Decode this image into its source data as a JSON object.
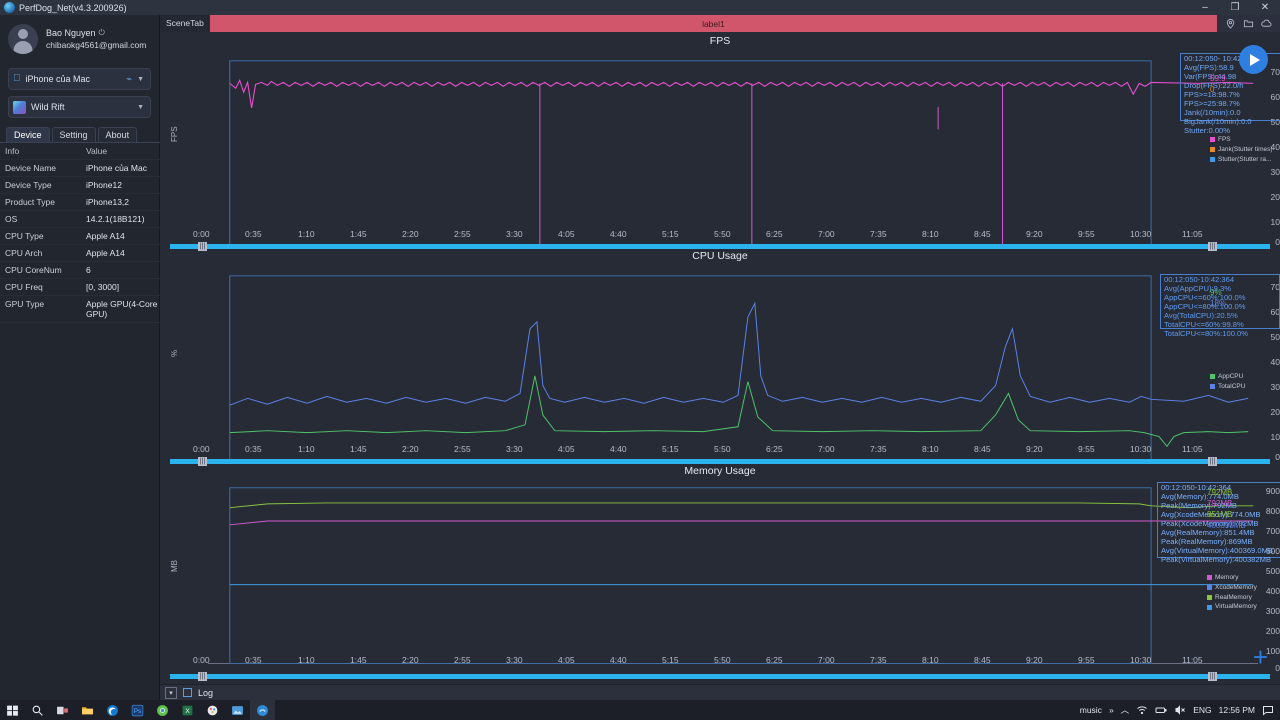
{
  "window": {
    "title": "PerfDog_Net(v4.3.200926)",
    "minimize": "–",
    "maximize": "❐",
    "close": "✕"
  },
  "sidebar": {
    "account": {
      "name": "Bao Nguyen",
      "power_icon": "⏻",
      "email": "chibaokg4561@gmail.com"
    },
    "device_combo": {
      "label": "iPhone của Mac",
      "apple_icon": "",
      "link_icon": "⌁",
      "caret": "▼"
    },
    "app_combo": {
      "label": "Wild Rift",
      "caret": "▼"
    },
    "tabs": [
      {
        "label": "Device",
        "active": true
      },
      {
        "label": "Setting",
        "active": false
      },
      {
        "label": "About",
        "active": false
      }
    ],
    "table": {
      "headers": [
        "Info",
        "Value"
      ],
      "rows": [
        [
          "Device Name",
          "iPhone của Mac"
        ],
        [
          "Device Type",
          "iPhone12"
        ],
        [
          "Product Type",
          "iPhone13,2"
        ],
        [
          "OS",
          "14.2.1(18B121)"
        ],
        [
          "CPU Type",
          "Apple A14"
        ],
        [
          "CPU Arch",
          "Apple A14"
        ],
        [
          "CPU CoreNum",
          "6"
        ],
        [
          "CPU Freq",
          "[0, 3000]"
        ],
        [
          "GPU Type",
          "Apple GPU(4-Core GPU)"
        ]
      ]
    }
  },
  "scenebar": {
    "label": "SceneTab",
    "tag": "label1",
    "tag_color": "#d1566b",
    "icons": [
      "location-pin-icon",
      "folder-icon",
      "cloud-icon"
    ]
  },
  "controls": {
    "play_label": "play-button",
    "add_label": "+",
    "log_checkbox_label": "Log",
    "expand_label": "▾"
  },
  "chart_data": [
    {
      "type": "line",
      "title": "FPS",
      "xlabel": "",
      "ylabel": "FPS",
      "ylim": [
        0,
        70
      ],
      "yticks": [
        0,
        10,
        20,
        30,
        40,
        50,
        60,
        70
      ],
      "xticks": [
        "0:00",
        "0:35",
        "1:10",
        "1:45",
        "2:20",
        "2:55",
        "3:30",
        "4:05",
        "4:40",
        "5:15",
        "5:50",
        "6:25",
        "7:00",
        "7:35",
        "8:10",
        "8:45",
        "9:20",
        "9:55",
        "10:30",
        "11:05"
      ],
      "grid": false,
      "legend_position": "right",
      "legend": [
        {
          "name": "FPS",
          "color": "#e84fd0"
        },
        {
          "name": "Jank(Stutter times)",
          "color": "#e8892a"
        },
        {
          "name": "Stutter(Stutter ra...",
          "color": "#3f9ae8"
        }
      ],
      "annotation": {
        "range": "00:12:050- 10:42:364",
        "lines": [
          "Avg(FPS):58.9",
          "Var(FPS):44.98",
          "Drop(FPS):22.0/h",
          "FPS>=18:98.7%",
          "FPS>=25:98.7%",
          "Jank(/10min):0.0",
          "BigJank(/10min):0.0",
          "Stutter:0.00%"
        ]
      },
      "current_values": [
        {
          "value": "59.9",
          "color": "#e84fd0"
        },
        {
          "value": "0",
          "color": "#e8892a"
        }
      ],
      "series": [
        {
          "name": "FPS",
          "color": "#e84fd0",
          "avg": 58.9,
          "baseline": 59.5
        }
      ]
    },
    {
      "type": "line",
      "title": "CPU Usage",
      "xlabel": "",
      "ylabel": "%",
      "ylim": [
        0,
        70
      ],
      "yticks": [
        0,
        10,
        20,
        30,
        40,
        50,
        60,
        70
      ],
      "xticks": [
        "0:00",
        "0:35",
        "1:10",
        "1:45",
        "2:20",
        "2:55",
        "3:30",
        "4:05",
        "4:40",
        "5:15",
        "5:50",
        "6:25",
        "7:00",
        "7:35",
        "8:10",
        "8:45",
        "9:20",
        "9:55",
        "10:30",
        "11:05"
      ],
      "grid": false,
      "legend_position": "right",
      "legend": [
        {
          "name": "AppCPU",
          "color": "#4fc46a"
        },
        {
          "name": "TotalCPU",
          "color": "#5c82e8"
        }
      ],
      "annotation": {
        "range": "00:12:050-10:42:364",
        "lines": [
          "Avg(AppCPU):9.3%",
          "AppCPU<=60%:100.0%",
          "AppCPU<=80%:100.0%",
          "Avg(TotalCPU):20.5%",
          "TotalCPU<=60%:99.8%",
          "TotalCPU<=80%:100.0%"
        ]
      },
      "current_values": [
        {
          "value": "9%",
          "color": "#4fc46a"
        },
        {
          "value": "18%",
          "color": "#5c82e8"
        }
      ],
      "series": [
        {
          "name": "AppCPU",
          "color": "#4fc46a",
          "avg": 9.3,
          "baseline": 9
        },
        {
          "name": "TotalCPU",
          "color": "#5c82e8",
          "avg": 20.5,
          "baseline": 20
        }
      ]
    },
    {
      "type": "line",
      "title": "Memory Usage",
      "xlabel": "",
      "ylabel": "MB",
      "ylim": [
        0,
        900
      ],
      "yticks": [
        0,
        100,
        200,
        300,
        400,
        500,
        600,
        700,
        800,
        900
      ],
      "xticks": [
        "0:00",
        "0:35",
        "1:10",
        "1:45",
        "2:20",
        "2:55",
        "3:30",
        "4:05",
        "4:40",
        "5:15",
        "5:50",
        "6:25",
        "7:00",
        "7:35",
        "8:10",
        "8:45",
        "9:20",
        "9:55",
        "10:30",
        "11:05"
      ],
      "grid": false,
      "legend_position": "right",
      "legend": [
        {
          "name": "Memory",
          "color": "#d05ad0"
        },
        {
          "name": "XcodeMemory",
          "color": "#5c82e8"
        },
        {
          "name": "RealMemory",
          "color": "#8cc63f"
        },
        {
          "name": "VirtualMemory",
          "color": "#3f9ae8"
        }
      ],
      "annotation": {
        "range": "00:12:050-10:42:364",
        "lines": [
          "Avg(Memory):774.0MB",
          "Peak(Memory):792MB",
          "Avg(XcodeMemory):774.0MB",
          "Peak(XcodeMemory):792MB",
          "Avg(RealMemory):851.4MB",
          "Peak(RealMemory):869MB",
          "Avg(VirtualMemory):400369.0MB",
          "Peak(VirtualMemory):400382MB"
        ]
      },
      "current_values": [
        {
          "value": "792MB",
          "color": "#8cc63f"
        },
        {
          "value": "792MB",
          "color": "#d05ad0"
        },
        {
          "value": "851MB",
          "color": "#8cc63f"
        },
        {
          "value": "400390MB",
          "color": "#5c82e8"
        }
      ],
      "series": [
        {
          "name": "RealMemory",
          "color": "#8cc63f",
          "baseline": 851
        },
        {
          "name": "Memory",
          "color": "#d05ad0",
          "baseline": 774
        },
        {
          "name": "VirtualMemory",
          "color": "#3f9ae8",
          "baseline": 400
        }
      ]
    }
  ],
  "taskbar": {
    "items": [
      "start-icon",
      "search-icon",
      "task-view-icon",
      "file-explorer-icon",
      "edge-icon",
      "photoshop-icon",
      "chrome-icon",
      "excel-icon",
      "paint-icon",
      "photos-icon",
      "perfdog-icon"
    ],
    "tray": {
      "music_label": "music",
      "overflow": "»",
      "chevron": "︿",
      "wifi_icon": "wifi-icon",
      "battery_icon": "battery-icon",
      "volume_icon": "volume-muted-icon",
      "language": "ENG",
      "time": "12:56 PM",
      "notification_icon": "notification-icon"
    }
  }
}
